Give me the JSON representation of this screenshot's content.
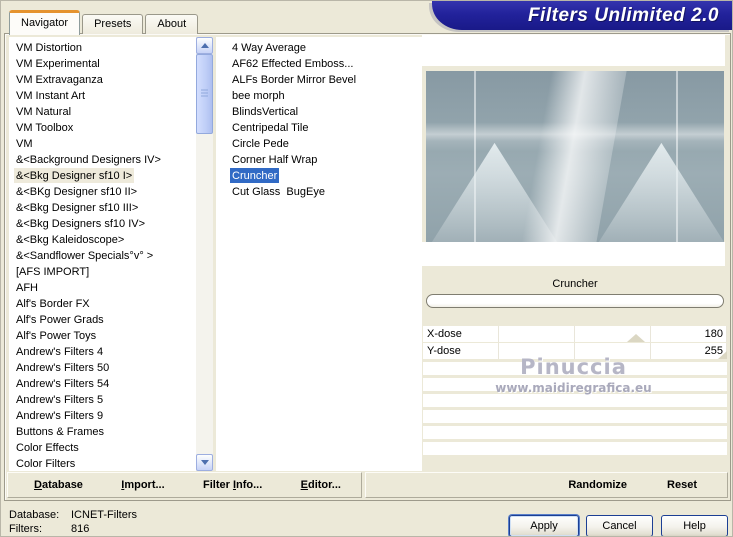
{
  "window": {
    "title_banner": "Filters Unlimited 2.0"
  },
  "tabs": [
    {
      "label": "Navigator",
      "active": true
    },
    {
      "label": "Presets",
      "active": false
    },
    {
      "label": "About",
      "active": false
    }
  ],
  "category_list": {
    "selected": "&<Bkg Designer sf10 I>",
    "items": [
      "VM Distortion",
      "VM Experimental",
      "VM Extravaganza",
      "VM Instant Art",
      "VM Natural",
      "VM Toolbox",
      "VM",
      "&<Background Designers IV>",
      "&<Bkg Designer sf10 I>",
      "&<BKg Designer sf10 II>",
      "&<Bkg Designer sf10 III>",
      "&<Bkg Designers sf10 IV>",
      "&<Bkg Kaleidoscope>",
      "&<Sandflower Specials°v° >",
      "[AFS IMPORT]",
      "AFH",
      "Alf's Border FX",
      "Alf's Power Grads",
      "Alf's Power Toys",
      "Andrew's Filters 4",
      "Andrew's Filters 50",
      "Andrew's Filters 54",
      "Andrew's Filters 5",
      "Andrew's Filters 9",
      "Buttons & Frames",
      "Color Effects",
      "Color Filters"
    ]
  },
  "filter_list": {
    "selected": "Cruncher",
    "items": [
      "4 Way Average",
      "AF62 Effected Emboss...",
      "ALFs Border Mirror Bevel",
      "bee morph",
      "BlindsVertical",
      "Centripedal Tile",
      "Circle Pede",
      "Corner Half Wrap",
      "Cruncher",
      "Cut Glass  BugEye"
    ]
  },
  "preview": {
    "filter_name": "Cruncher"
  },
  "controls": {
    "sliders": [
      {
        "label": "X-dose",
        "value": "180",
        "position_pct": 70
      },
      {
        "label": "Y-dose",
        "value": "255",
        "position_pct": 100
      }
    ]
  },
  "watermark": {
    "line1": "Pinuccia",
    "line2": "www.maidiregrafica.eu"
  },
  "action_bar": {
    "left": [
      {
        "name": "database-button",
        "pre": "",
        "key": "D",
        "post": "atabase"
      },
      {
        "name": "import-button",
        "pre": "",
        "key": "I",
        "post": "mport..."
      },
      {
        "name": "filter-info-button",
        "pre": "Filter ",
        "key": "I",
        "post": "nfo..."
      },
      {
        "name": "editor-button",
        "pre": "",
        "key": "E",
        "post": "ditor..."
      }
    ],
    "right": [
      {
        "name": "randomize-button",
        "label": "Randomize"
      },
      {
        "name": "reset-button",
        "label": "Reset"
      }
    ]
  },
  "status": {
    "database_label": "Database:",
    "database_value": "ICNET-Filters",
    "filters_label": "Filters:",
    "filters_value": "816"
  },
  "dialog_buttons": [
    {
      "name": "apply-button",
      "label": "Apply",
      "default": true
    },
    {
      "name": "cancel-button",
      "label": "Cancel",
      "default": false
    },
    {
      "name": "help-button",
      "label": "Help",
      "default": false
    }
  ],
  "colors": {
    "window_bg": "#ece9d8",
    "banner_bg": "#22229b",
    "selection_bg": "#316ac5",
    "inactive_selection_bg": "#eeeadb",
    "tab_accent": "#e5932f",
    "scrollbar_thumb": "#c4d2f8"
  }
}
